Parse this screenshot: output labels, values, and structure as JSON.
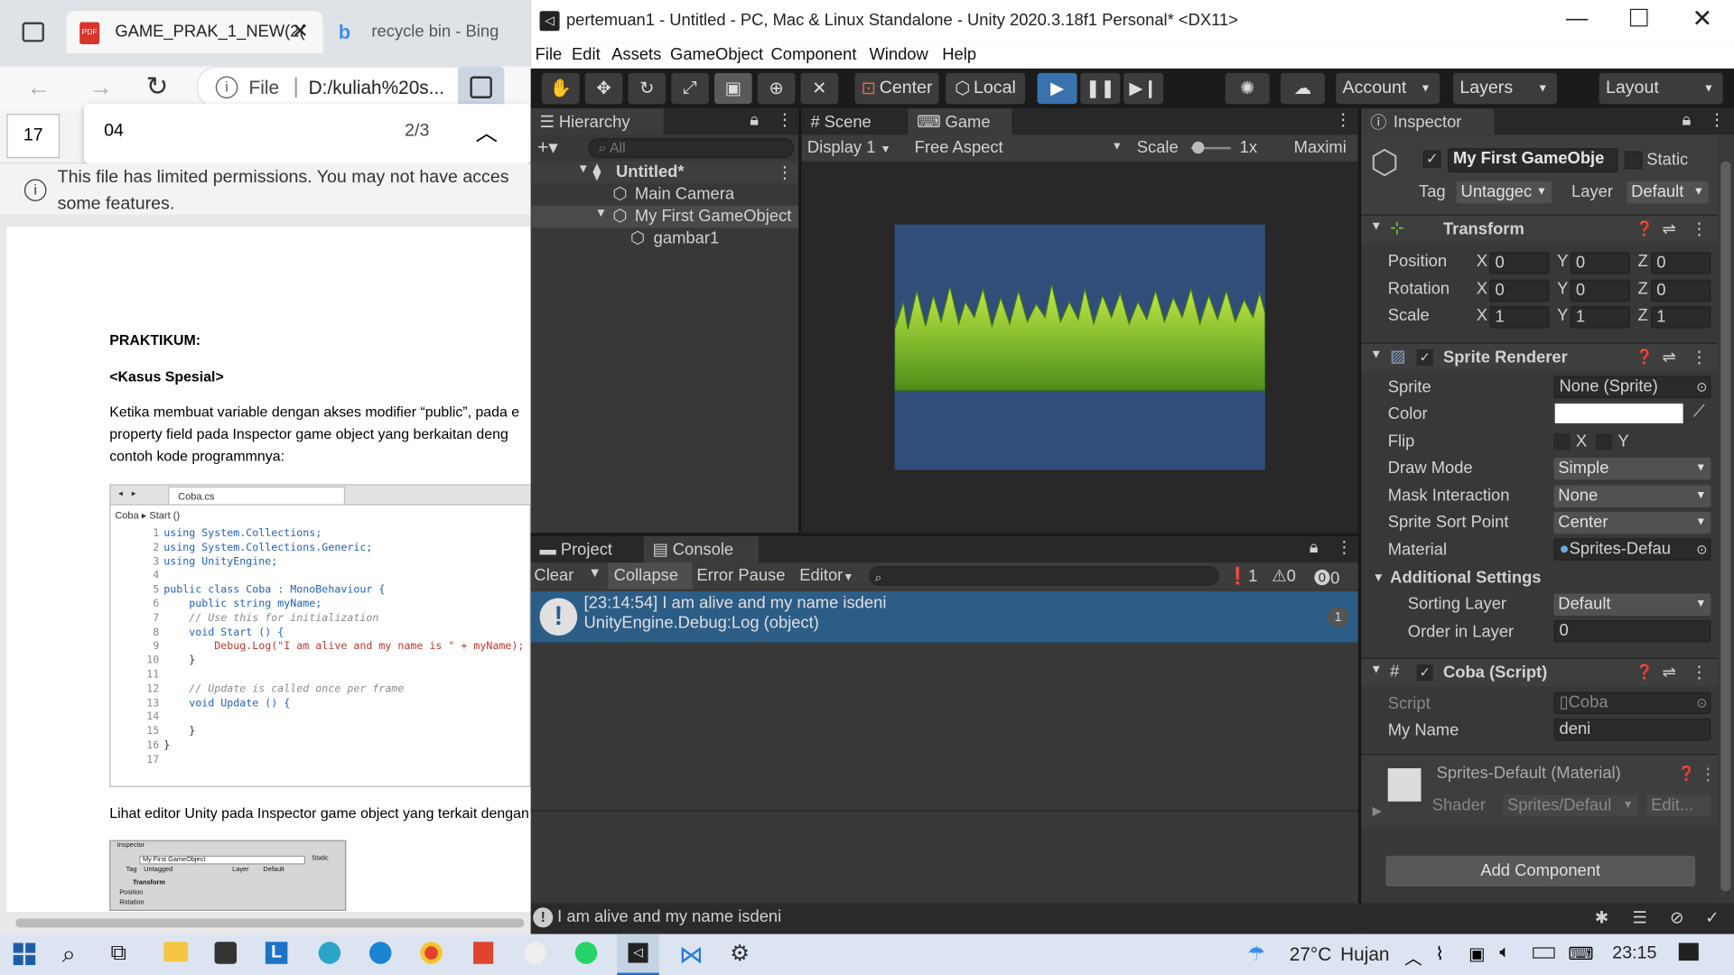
{
  "edge": {
    "tabs": [
      {
        "label": "GAME_PRAK_1_NEW(2("
      },
      {
        "label": "recycle bin - Bing"
      }
    ],
    "address": {
      "prefix": "File",
      "url": "D:/kuliah%20s..."
    },
    "pdf": {
      "page": "17",
      "search_value": "04",
      "search_count": "2/3"
    },
    "notice": "This file has limited permissions. You may not have access to some features.",
    "notice_line1": "This file has limited permissions. You may not have acces",
    "notice_line2": "some features.",
    "doc": {
      "heading": "PRAKTIKUM:",
      "subheading": "<Kasus Spesial>",
      "para1_l1": "Ketika membuat variable dengan akses modifier “public”, pada e",
      "para1_l2": "property field pada Inspector game object yang berkaitan deng",
      "para1_l3": "contoh kode programmnya:",
      "code_tab": "Coba.cs",
      "code_crumb1": "Coba",
      "code_crumb2": "Start ()",
      "code_lines": [
        "using System.Collections;",
        "using System.Collections.Generic;",
        "using UnityEngine;",
        "",
        "public class Coba : MonoBehaviour {",
        "    public string myName;",
        "    // Use this for initialization",
        "    void Start () {",
        "        Debug.Log(\"I am alive and my name is \" + myName);",
        "    }",
        "",
        "    // Update is called once per frame",
        "    void Update () {",
        "",
        "    }",
        "}",
        ""
      ],
      "para2": "Lihat editor Unity pada Inspector game object yang terkait dengan",
      "thumb_title": "Inspector",
      "thumb_obj": "My First GameObject",
      "thumb_static": "Static",
      "thumb_tag": "Tag",
      "thumb_untagged": "Untagged",
      "thumb_layer": "Layer",
      "thumb_default": "Default",
      "thumb_transform": "Transform",
      "thumb_position": "Position",
      "thumb_rotation": "Rotation"
    }
  },
  "unity": {
    "title": "pertemuan1 - Untitled - PC, Mac & Linux Standalone - Unity 2020.3.18f1 Personal* <DX11>",
    "menu": [
      "File",
      "Edit",
      "Assets",
      "GameObject",
      "Component",
      "Window",
      "Help"
    ],
    "toolbar": {
      "center": "Center",
      "local": "Local",
      "account": "Account",
      "layers": "Layers",
      "layout": "Layout"
    },
    "hierarchy": {
      "tab": "Hierarchy",
      "search_placeholder": "All",
      "scene": "Untitled*",
      "items": [
        "Main Camera",
        "My First GameObject",
        "gambar1"
      ]
    },
    "game": {
      "scene_tab": "Scene",
      "game_tab": "Game",
      "display": "Display 1",
      "aspect": "Free Aspect",
      "scale_label": "Scale",
      "scale_value": "1x",
      "maximize": "Maximi"
    },
    "console": {
      "project_tab": "Project",
      "console_tab": "Console",
      "clear": "Clear",
      "collapse": "Collapse",
      "error_pause": "Error Pause",
      "editor": "Editor",
      "count_info": "1",
      "count_warn": "0",
      "count_err": "0",
      "log_line1": "[23:14:54] I am alive and my name isdeni",
      "log_line2": "UnityEngine.Debug:Log (object)",
      "log_count": "1"
    },
    "status": "I am alive and my name isdeni",
    "inspector": {
      "tab": "Inspector",
      "object_name": "My First GameObje",
      "static": "Static",
      "tag_label": "Tag",
      "tag_value": "Untaggec",
      "layer_label": "Layer",
      "layer_value": "Default",
      "transform": {
        "title": "Transform",
        "position": {
          "label": "Position",
          "x": "0",
          "y": "0",
          "z": "0"
        },
        "rotation": {
          "label": "Rotation",
          "x": "0",
          "y": "0",
          "z": "0"
        },
        "scale": {
          "label": "Scale",
          "x": "1",
          "y": "1",
          "z": "1"
        }
      },
      "sprite_renderer": {
        "title": "Sprite Renderer",
        "sprite_label": "Sprite",
        "sprite_value": "None (Sprite)",
        "color_label": "Color",
        "flip_label": "Flip",
        "flip_x": "X",
        "flip_y": "Y",
        "draw_mode_label": "Draw Mode",
        "draw_mode_value": "Simple",
        "mask_label": "Mask Interaction",
        "mask_value": "None",
        "sort_point_label": "Sprite Sort Point",
        "sort_point_value": "Center",
        "material_label": "Material",
        "material_value": "Sprites-Defau",
        "additional": "Additional Settings",
        "sorting_layer_label": "Sorting Layer",
        "sorting_layer_value": "Default",
        "order_label": "Order in Layer",
        "order_value": "0"
      },
      "script": {
        "title": "Coba (Script)",
        "script_label": "Script",
        "script_value": "Coba",
        "myname_label": "My Name",
        "myname_value": "deni"
      },
      "material": {
        "title": "Sprites-Default (Material)",
        "shader_label": "Shader",
        "shader_value": "Sprites/Defaul",
        "edit": "Edit..."
      },
      "add_component": "Add Component"
    }
  },
  "taskbar": {
    "temp": "27°C",
    "weather": "Hujan",
    "time": "23:15"
  },
  "colors": {
    "unity_play_blue": "#3a72b0",
    "game_bg": "#314d79",
    "console_selected": "#2c5d87"
  }
}
